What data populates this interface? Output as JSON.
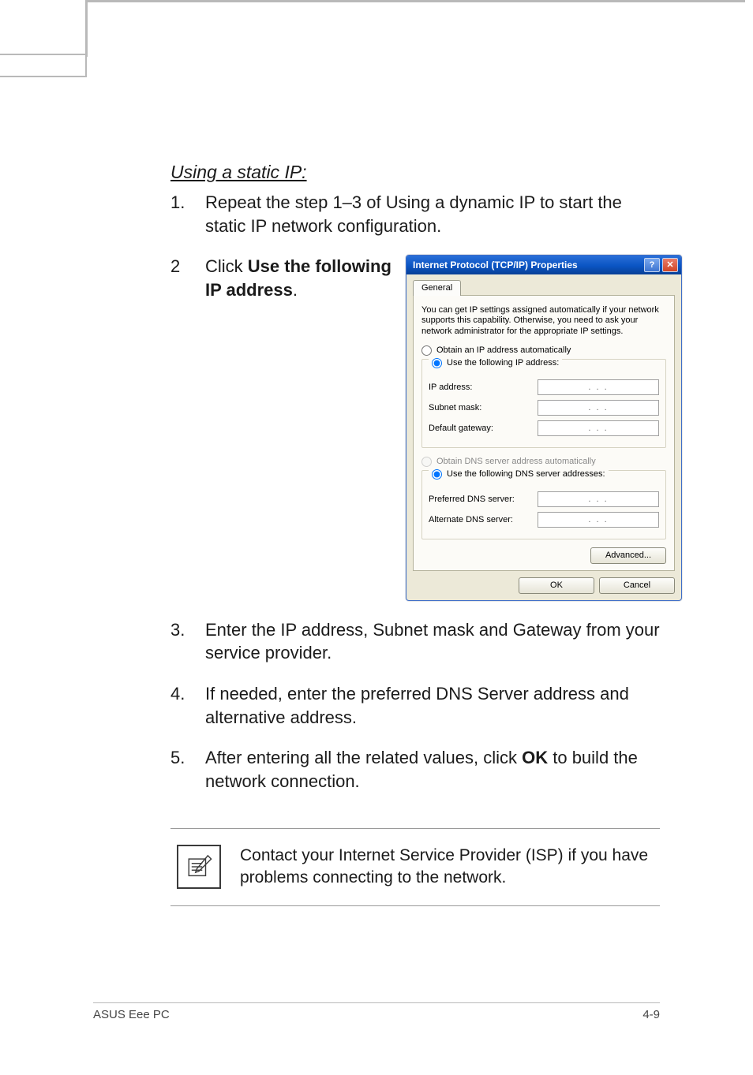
{
  "section": {
    "title": "Using a static IP:"
  },
  "steps": {
    "s1": {
      "num": "1.",
      "text": "Repeat the step 1–3 of Using a dynamic IP to start the static IP network configuration."
    },
    "s2": {
      "num": "2",
      "text_prefix": "Click",
      "text_bold": "Use the following IP address",
      "text_suffix": "."
    },
    "s3": {
      "num": "3.",
      "text": "Enter the IP address, Subnet mask and Gateway from your service provider."
    },
    "s4": {
      "num": "4.",
      "text": "If needed, enter the preferred DNS Server address and alternative address."
    },
    "s5": {
      "num": "5.",
      "text_prefix": "After entering all the related values, click",
      "text_bold": "OK",
      "text_suffix": "to build the network connection."
    }
  },
  "dialog": {
    "title": "Internet Protocol (TCP/IP) Properties",
    "help_symbol": "?",
    "close_symbol": "✕",
    "tab": "General",
    "desc": "You can get IP settings assigned automatically if your network supports this capability. Otherwise, you need to ask your network administrator for the appropriate IP settings.",
    "radio_auto_ip": "Obtain an IP address automatically",
    "radio_static_ip": "Use the following IP address:",
    "label_ip": "IP address:",
    "label_subnet": "Subnet mask:",
    "label_gateway": "Default gateway:",
    "radio_auto_dns": "Obtain DNS server address automatically",
    "radio_static_dns": "Use the following DNS server addresses:",
    "label_pref_dns": "Preferred DNS server:",
    "label_alt_dns": "Alternate DNS server:",
    "ip_placeholder": ".     .     .",
    "btn_advanced": "Advanced...",
    "btn_ok": "OK",
    "btn_cancel": "Cancel"
  },
  "note": {
    "text": "Contact your Internet Service Provider (ISP) if you have problems connecting to the network."
  },
  "footer": {
    "left": "ASUS Eee PC",
    "right": "4-9"
  }
}
